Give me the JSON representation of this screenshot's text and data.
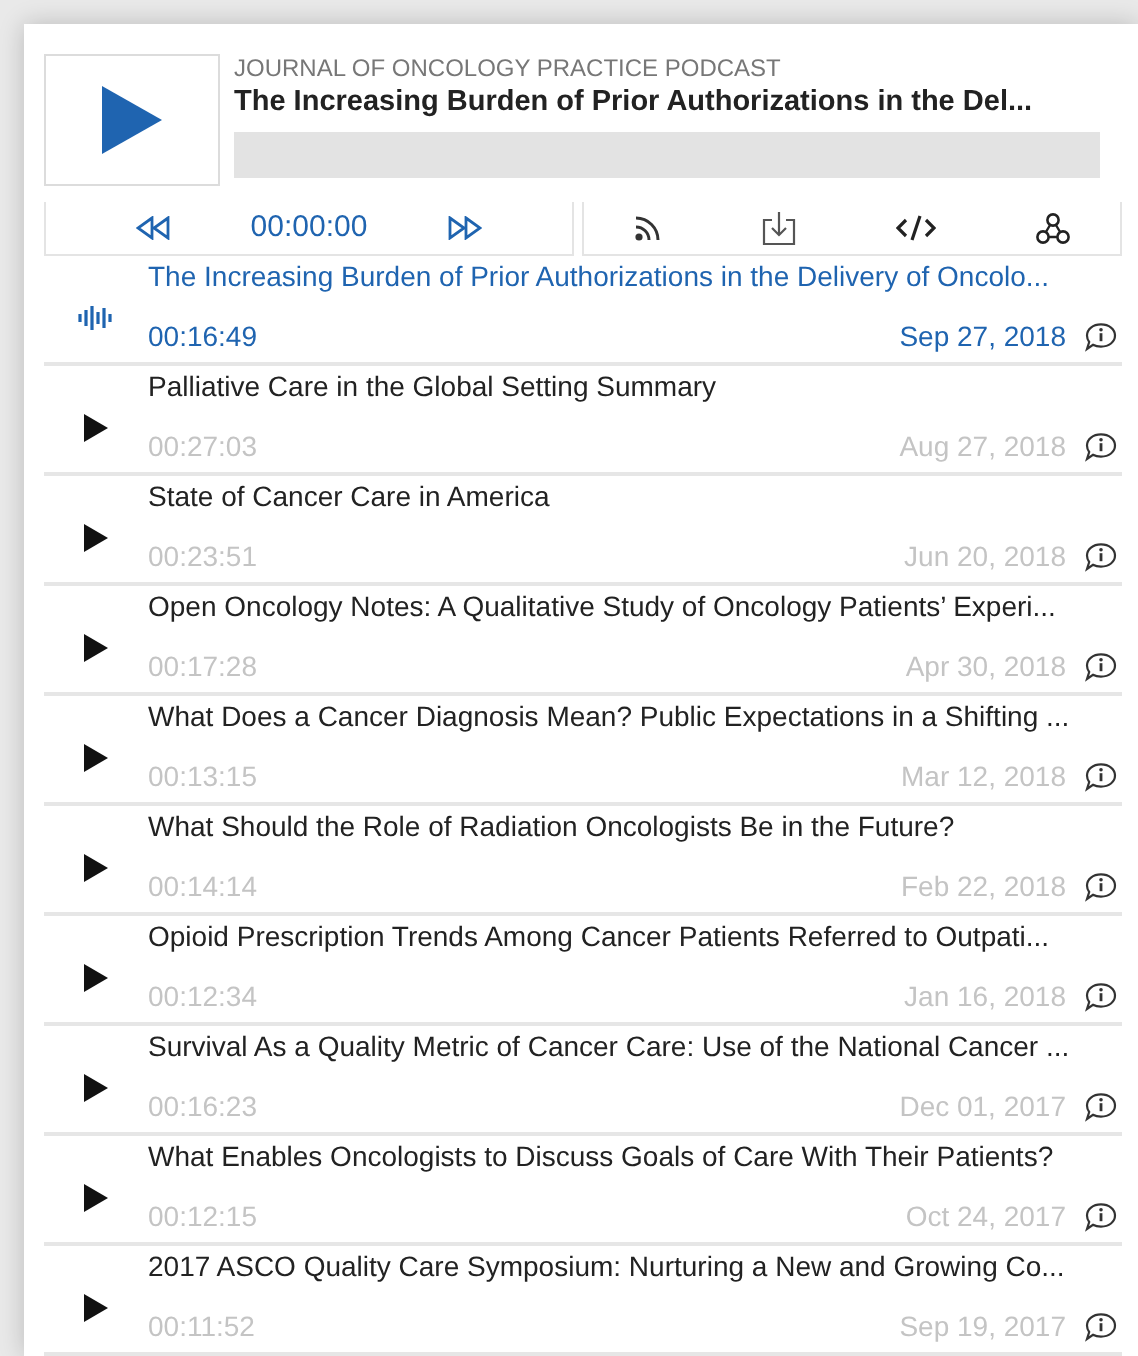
{
  "player": {
    "podcast": "JOURNAL OF ONCOLOGY PRACTICE PODCAST",
    "title": "The Increasing Burden of Prior Authorizations in the Del...",
    "time": "00:00:00"
  },
  "episodes": [
    {
      "title": "The Increasing Burden of Prior Authorizations in the Delivery of Oncolo...",
      "duration": "00:16:49",
      "date": "Sep 27, 2018",
      "selected": true
    },
    {
      "title": "Palliative Care in the Global Setting Summary",
      "duration": "00:27:03",
      "date": "Aug 27, 2018",
      "selected": false
    },
    {
      "title": "State of Cancer Care in America",
      "duration": "00:23:51",
      "date": "Jun 20, 2018",
      "selected": false
    },
    {
      "title": "Open Oncology Notes: A Qualitative Study of Oncology Patients’ Experi...",
      "duration": "00:17:28",
      "date": "Apr 30, 2018",
      "selected": false
    },
    {
      "title": "What Does a Cancer Diagnosis Mean? Public Expectations in a Shifting ...",
      "duration": "00:13:15",
      "date": "Mar 12, 2018",
      "selected": false
    },
    {
      "title": "What Should the Role of Radiation Oncologists Be in the Future?",
      "duration": "00:14:14",
      "date": "Feb 22, 2018",
      "selected": false
    },
    {
      "title": "Opioid Prescription Trends Among Cancer Patients Referred to Outpati...",
      "duration": "00:12:34",
      "date": "Jan 16, 2018",
      "selected": false
    },
    {
      "title": "Survival As a Quality Metric of Cancer Care: Use of the National Cancer ...",
      "duration": "00:16:23",
      "date": "Dec 01, 2017",
      "selected": false
    },
    {
      "title": "What Enables Oncologists to Discuss Goals of Care With Their Patients?",
      "duration": "00:12:15",
      "date": "Oct 24, 2017",
      "selected": false
    },
    {
      "title": "2017 ASCO Quality Care Symposium: Nurturing a New and Growing Co...",
      "duration": "00:11:52",
      "date": "Sep 19, 2017",
      "selected": false
    }
  ]
}
